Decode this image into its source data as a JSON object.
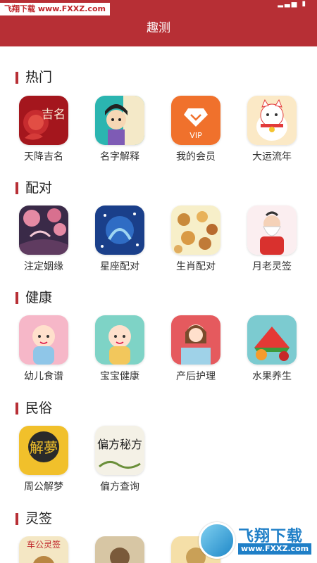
{
  "top_watermark": "飞翔下载 www.FXXZ.com",
  "header": {
    "title": "趣测"
  },
  "sections": [
    {
      "title": "热门",
      "items": [
        {
          "label": "天降吉名"
        },
        {
          "label": "名字解释"
        },
        {
          "label": "我的会员"
        },
        {
          "label": "大运流年"
        }
      ]
    },
    {
      "title": "配对",
      "items": [
        {
          "label": "注定姻缘"
        },
        {
          "label": "星座配对"
        },
        {
          "label": "生肖配对"
        },
        {
          "label": "月老灵签"
        }
      ]
    },
    {
      "title": "健康",
      "items": [
        {
          "label": "幼儿食谱"
        },
        {
          "label": "宝宝健康"
        },
        {
          "label": "产后护理"
        },
        {
          "label": "水果养生"
        }
      ]
    },
    {
      "title": "民俗",
      "items": [
        {
          "label": "周公解梦"
        },
        {
          "label": "偏方查询"
        }
      ]
    },
    {
      "title": "灵签",
      "items": []
    }
  ],
  "icon_text": {
    "jiming": "吉名",
    "vip": "VIP",
    "jiemeng": "解夢",
    "pianfang": "偏方秘方",
    "chegong": "车公灵签"
  },
  "bottom_watermark": {
    "brand": "飞翔下载",
    "url": "www.FXXZ.com"
  },
  "colors": {
    "brand_red": "#b72f35",
    "watermark_blue": "#1f7fc7"
  }
}
